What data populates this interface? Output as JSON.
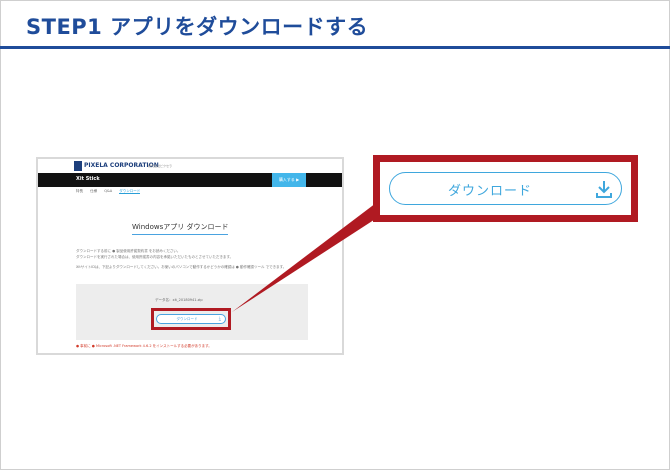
{
  "header": {
    "title": "STEP1  アプリをダウンロードする"
  },
  "mini_page": {
    "company": "PIXELA CORPORATION",
    "company_sub": "株式会社ピクセラ",
    "product": "Xit Stick",
    "buy_label": "購入する ▶",
    "subnav": [
      "特長",
      "仕様",
      "Q&A",
      "ダウンロード"
    ],
    "heading": "Windowsアプリ ダウンロード",
    "para1": "ダウンロードする前に ● 製品使用許諾契約書 をお読みください。",
    "para2": "ダウンロードを実行された場合は、使用許諾書の内容を承諾いただいたものとさせていただきます。",
    "para3": "XitサイトIDは、下記よりダウンロードしてください。お使いのパソコンで動作するかどうかの確認は ● 動作確認ツール でできます。",
    "filename": "データ名：xit_20180941.zip",
    "download_label": "ダウンロード",
    "note": "● 事前に ● Microsoft .NET Framework 4.6.2 をインストールする必要があります。"
  },
  "callout": {
    "download_label": "ダウンロード"
  },
  "colors": {
    "brand_blue": "#1f4c9a",
    "highlight_red": "#b01a22",
    "button_blue": "#3fa7dd"
  }
}
